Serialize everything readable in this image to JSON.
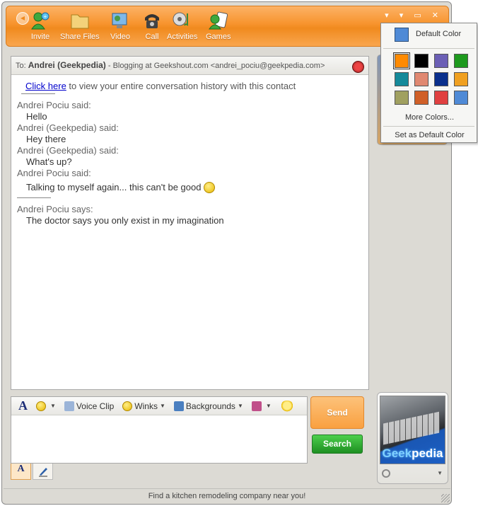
{
  "toolbar": {
    "items": [
      {
        "label": "Invite",
        "icon": "invite-icon"
      },
      {
        "label": "Share Files",
        "icon": "folder-icon"
      },
      {
        "label": "Video",
        "icon": "video-icon"
      },
      {
        "label": "Call",
        "icon": "phone-icon"
      },
      {
        "label": "Activities",
        "icon": "activities-icon"
      },
      {
        "label": "Games",
        "icon": "games-icon"
      }
    ],
    "window_controls": "▾ ▾ ▭ ✕"
  },
  "conversation": {
    "to_label": "To:",
    "contact_name": "Andrei (Geekpedia)",
    "contact_status": "- Blogging at Geekshout.com <andrei_pociu@geekpedia.com>",
    "history_link": "Click here",
    "history_text": " to view your entire conversation history with this contact",
    "messages": [
      {
        "sender": "Andrei Pociu said:",
        "text": "Hello"
      },
      {
        "sender": "Andrei (Geekpedia) said:",
        "text": "Hey there"
      },
      {
        "sender": "Andrei (Geekpedia) said:",
        "text": "What's up?"
      },
      {
        "sender": "Andrei Pociu said:",
        "text": "Talking to myself again... this can't be good"
      }
    ],
    "typing": {
      "sender": "Andrei Pociu says:",
      "text": "The doctor says you only exist in my imagination"
    }
  },
  "input_tools": {
    "font": "A",
    "voice_clip": "Voice Clip",
    "winks": "Winks",
    "backgrounds": "Backgrounds"
  },
  "buttons": {
    "send": "Send",
    "search": "Search"
  },
  "avatar": {
    "logo_part1": "Geek",
    "logo_part2": "pedia"
  },
  "status_bar": "Find a kitchen remodeling company near you!",
  "color_menu": {
    "default_label": "Default Color",
    "default_color": "#4f8ad6",
    "swatches": [
      "#ff8a00",
      "#000000",
      "#6b5fb5",
      "#1e9a1e",
      "#158a9a",
      "#e08870",
      "#0a2f8c",
      "#f0a020",
      "#a0a060",
      "#d06028",
      "#e04040",
      "#4f8ad6"
    ],
    "more_colors": "More Colors...",
    "set_default": "Set as Default Color"
  }
}
